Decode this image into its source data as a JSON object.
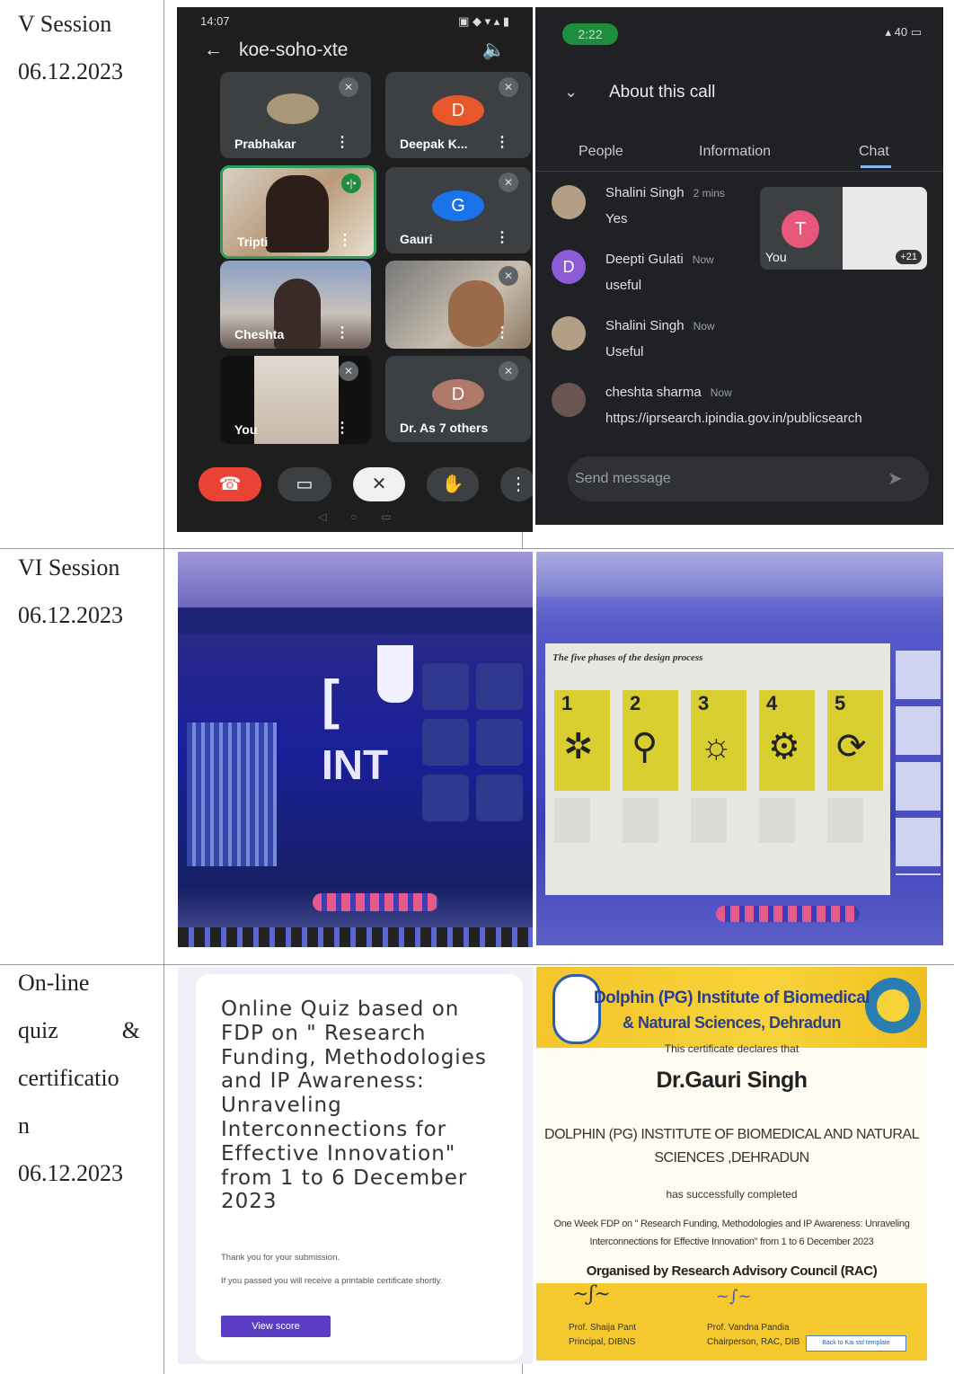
{
  "rows": [
    {
      "title": "V Session",
      "date": "06.12.2023"
    },
    {
      "title": "VI Session",
      "date": "06.12.2023"
    },
    {
      "title_lines": [
        "On-line",
        "quiz",
        "&",
        "certificatio",
        "n"
      ],
      "date": "06.12.2023"
    }
  ],
  "meet": {
    "status_time": "14:07",
    "meeting_code": "koe-soho-xte",
    "tiles": [
      {
        "name": "Prabhakar",
        "initial": ""
      },
      {
        "name": "Deepak K...",
        "initial": "D"
      },
      {
        "name": "Tripti",
        "initial": ""
      },
      {
        "name": "Gauri",
        "initial": "G"
      },
      {
        "name": "Cheshta",
        "initial": ""
      },
      {
        "name": "",
        "initial": ""
      },
      {
        "name": "You",
        "initial": ""
      },
      {
        "name": "Dr. As   7 others",
        "initial": "D"
      }
    ]
  },
  "chat": {
    "status_time": "2:22",
    "signal": "40",
    "heading": "About this call",
    "tabs": [
      "People",
      "Information",
      "Chat"
    ],
    "you_initial": "T",
    "you_label": "You",
    "overflow": "+21",
    "messages": [
      {
        "sender": "Shalini Singh",
        "time": "2 mins",
        "text": "Yes",
        "initial": ""
      },
      {
        "sender": "Deepti Gulati",
        "time": "Now",
        "text": "useful",
        "initial": "D"
      },
      {
        "sender": "Shalini Singh",
        "time": "Now",
        "text": "Useful",
        "initial": ""
      },
      {
        "sender": "cheshta sharma",
        "time": "Now",
        "text": "https://iprsearch.ipindia.gov.in/publicsearch",
        "initial": ""
      }
    ],
    "send_placeholder": "Send message"
  },
  "slide": {
    "title": "The five phases of the design process",
    "phases": [
      "1",
      "2",
      "3",
      "4",
      "5"
    ]
  },
  "quiz": {
    "title": "Online Quiz based on FDP on \" Research Funding, Methodologies and IP Awareness: Unraveling Interconnections for Effective Innovation\" from 1 to 6 December 2023",
    "thanks": "Thank you for your submission.",
    "note": "If you passed you will receive a printable certificate shortly.",
    "button": "View score"
  },
  "certificate": {
    "institute_line1": "Dolphin (PG) Institute of Biomedical",
    "institute_line2": "& Natural Sciences, Dehradun",
    "declares": "This certificate declares that",
    "recipient": "Dr.Gauri Singh",
    "affiliation_line1": "DOLPHIN (PG) INSTITUTE OF BIOMEDICAL AND NATURAL",
    "affiliation_line2": "SCIENCES ,DEHRADUN",
    "completed": "has successfully completed",
    "program_line1": "One Week FDP on \" Research Funding, Methodologies and IP Awareness: Unraveling",
    "program_line2": "Interconnections for Effective Innovation\" from 1 to 6 December 2023",
    "organised": "Organised by Research Advisory Council (RAC)",
    "sig1_name": "Prof. Shaija Pant",
    "sig1_role": "Principal, DIBNS",
    "sig2_name": "Prof. Vandna Pandia",
    "sig2_role": "Chairperson, RAC, DIB",
    "badge": "Back to Kai std template"
  }
}
